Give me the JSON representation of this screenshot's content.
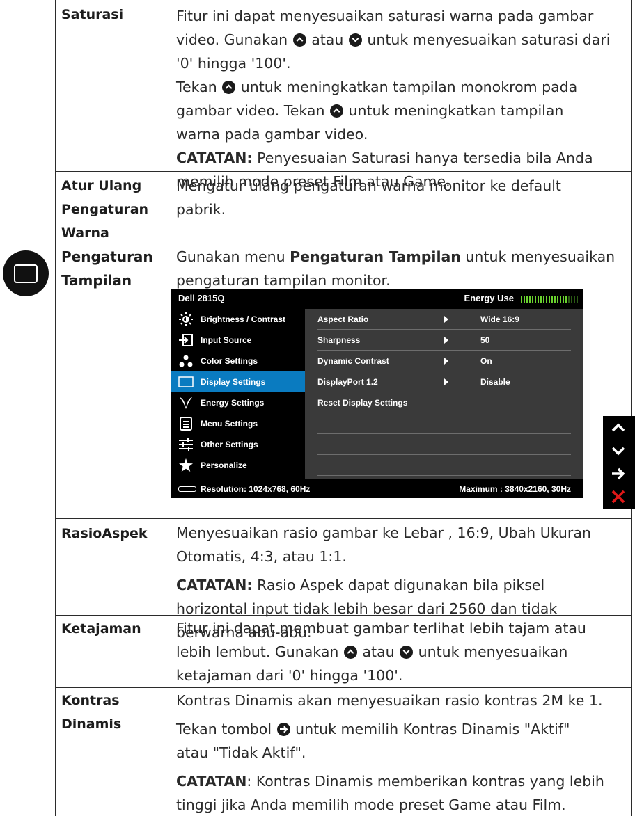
{
  "saturasi": {
    "label": "Saturasi",
    "l1": "Fitur ini dapat menyesuaikan saturasi warna pada gambar",
    "l2a": "video. Gunakan ",
    "l2b": " atau ",
    "l2c": " untuk menyesuaikan saturasi dari",
    "l3": "'0' hingga '100'.",
    "l4a": "Tekan ",
    "l4b": " untuk meningkatkan tampilan monokrom pada",
    "l5a": "gambar video. Tekan ",
    "l5b": " untuk meningkatkan tampilan",
    "l6": "warna pada gambar video.",
    "note_label": "CATATAN:",
    "note1": " Penyesuaian Saturasi hanya tersedia bila Anda",
    "note2": "memilih mode preset Film atau Game."
  },
  "reset_color": {
    "label1": "Atur Ulang",
    "label2": "Pengaturan",
    "label3": "Warna",
    "l1": "Mengatur ulang pengaturan warna monitor ke default",
    "l2": "pabrik."
  },
  "display_settings": {
    "label1": "Pengaturan",
    "label2": "Tampilan",
    "l1a": "Gunakan menu ",
    "l1b": "Pengaturan Tampilan",
    "l1c": " untuk menyesuaikan",
    "l2": "pengaturan tampilan monitor."
  },
  "osd": {
    "title": "Dell 2815Q",
    "energy_label": "Energy Use",
    "menu": [
      {
        "label": "Brightness / Contrast",
        "icon": "brightness-icon"
      },
      {
        "label": "Input Source",
        "icon": "input-source-icon"
      },
      {
        "label": "Color Settings",
        "icon": "color-settings-icon"
      },
      {
        "label": "Display Settings",
        "icon": "display-settings-icon"
      },
      {
        "label": "Energy Settings",
        "icon": "energy-settings-icon"
      },
      {
        "label": "Menu Settings",
        "icon": "menu-settings-icon"
      },
      {
        "label": "Other Settings",
        "icon": "other-settings-icon"
      },
      {
        "label": "Personalize",
        "icon": "personalize-icon"
      }
    ],
    "rows": [
      {
        "key": "Aspect Ratio",
        "value": "Wide 16:9"
      },
      {
        "key": "Sharpness",
        "value": "50"
      },
      {
        "key": "Dynamic Contrast",
        "value": "On"
      },
      {
        "key": "DisplayPort 1.2",
        "value": "Disable"
      },
      {
        "key": "Reset Display Settings",
        "value": ""
      }
    ],
    "resolution": "Resolution: 1024x768,  60Hz",
    "maximum": "Maximum : 3840x2160,  30Hz",
    "selected_color": "#0a7bc0",
    "energy_color": "#6ad22e"
  },
  "nav_buttons": [
    "up-arrow-icon",
    "down-arrow-icon",
    "right-arrow-icon",
    "close-icon"
  ],
  "aspect": {
    "label": "RasioAspek",
    "l1": "Menyesuaikan rasio gambar ke Lebar , 16:9, Ubah Ukuran",
    "l2": "Otomatis, 4:3, atau 1:1.",
    "note_label": "CATATAN:",
    "n1": " Rasio Aspek dapat digunakan bila piksel",
    "n2": "horizontal input tidak lebih besar dari 2560 dan tidak",
    "n3": "berwarna abu-abu."
  },
  "sharpness": {
    "label": "Ketajaman",
    "l1": "Fitur ini dapat membuat gambar terlihat lebih tajam atau",
    "l2a": "lebih lembut. Gunakan ",
    "l2b": " atau ",
    "l2c": " untuk menyesuaikan",
    "l3": "ketajaman dari '0' hingga '100'."
  },
  "dyncontrast": {
    "label1": "Kontras",
    "label2": "Dinamis",
    "l1": "Kontras Dinamis akan menyesuaikan rasio kontras 2M ke 1.",
    "l2a": "Tekan tombol ",
    "l2b": " untuk memilih Kontras Dinamis \"Aktif\"",
    "l3": "atau \"Tidak Aktif\".",
    "note_label": "CATATAN",
    "n1": ": Kontras Dinamis memberikan kontras yang lebih",
    "n2": "tinggi jika Anda memilih mode preset Game atau Film."
  }
}
